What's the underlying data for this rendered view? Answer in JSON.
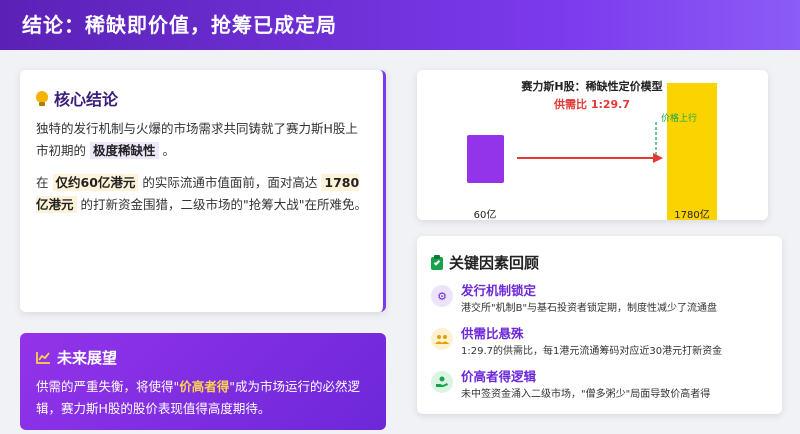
{
  "header": {
    "title": "结论：稀缺即价值，抢筹已成定局"
  },
  "conclusion": {
    "title": "核心结论",
    "p1_pre": "独特的发行机制与火爆的市场需求共同铸就了赛力斯H股上市初期的",
    "p1_hl": "极度稀缺性",
    "p1_post": "。",
    "p2_pre": "在",
    "p2_hl1": "仅约60亿港元",
    "p2_mid": "的实际流通市值面前，面对高达",
    "p2_hl2": "1780亿港元",
    "p2_post": "的打新资金围猎，二级市场的\"抢筹大战\"在所难免。"
  },
  "outlook": {
    "title": "未来展望",
    "pre": "供需的严重失衡，将使得\"",
    "gold": "价高者得",
    "post": "\"成为市场运行的必然逻辑，赛力斯H股的股价表现值得高度期待。"
  },
  "model": {
    "title": "赛力斯H股：稀缺性定价模型",
    "ratio": "供需比 1:29.7",
    "annotation": "价格上行",
    "left_label": "60亿",
    "right_label": "1780亿",
    "colors": {
      "supply": "#9333ea",
      "demand": "#fbd400",
      "arrow": "#e53935",
      "annotation": "#15a34a"
    }
  },
  "chart_data": {
    "type": "bar",
    "title": "赛力斯H股：稀缺性定价模型",
    "subtitle": "供需比 1:29.7",
    "categories": [
      "60亿",
      "1780亿"
    ],
    "values": [
      60,
      1780
    ],
    "annotations": [
      "价格上行"
    ]
  },
  "factors": {
    "title": "关键因素回顾",
    "items": [
      {
        "icon": "gears-icon",
        "title": "发行机制锁定",
        "desc": "港交所\"机制B\"与基石投资者锁定期，制度性减少了流通盘"
      },
      {
        "icon": "users-icon",
        "title": "供需比悬殊",
        "desc": "1:29.7的供需比，每1港元流通筹码对应近30港元打新资金"
      },
      {
        "icon": "hand-money-icon",
        "title": "价高者得逻辑",
        "desc": "未中签资金涌入二级市场，\"僧多粥少\"局面导致价高者得"
      }
    ]
  }
}
